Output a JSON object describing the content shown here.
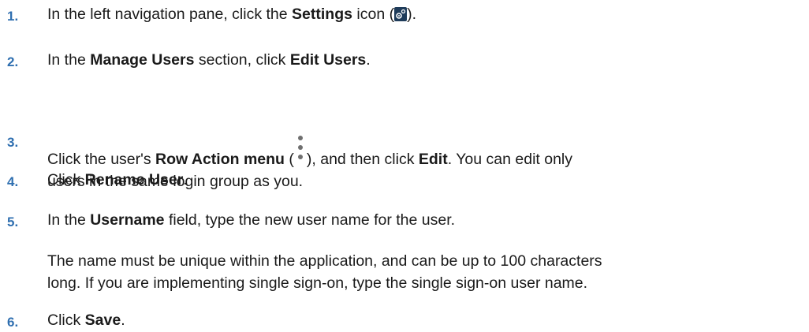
{
  "steps": [
    {
      "number": "1.",
      "lines": [
        [
          {
            "t": "In the left navigation pane, click the ",
            "b": false
          },
          {
            "t": "Settings",
            "b": true
          },
          {
            "t": " icon (",
            "b": false
          },
          {
            "icon": "gear-icon"
          },
          {
            "t": ").",
            "b": false
          }
        ]
      ]
    },
    {
      "number": "2.",
      "lines": [
        [
          {
            "t": "In the ",
            "b": false
          },
          {
            "t": "Manage Users",
            "b": true
          },
          {
            "t": " section, click ",
            "b": false
          },
          {
            "t": "Edit Users",
            "b": true
          },
          {
            "t": ".",
            "b": false
          }
        ]
      ]
    },
    {
      "number": "3.",
      "lines": [
        [
          {
            "t": "Click the user's ",
            "b": false
          },
          {
            "t": "Row Action menu",
            "b": true
          },
          {
            "t": " (",
            "b": false
          },
          {
            "icon": "kebab-icon"
          },
          {
            "t": "), and then click ",
            "b": false
          },
          {
            "t": "Edit",
            "b": true
          },
          {
            "t": ". You can edit only",
            "b": false
          }
        ],
        [
          {
            "t": "users in the same login group as you.",
            "b": false
          }
        ]
      ]
    },
    {
      "number": "4.",
      "lines": [
        [
          {
            "t": "Click ",
            "b": false
          },
          {
            "t": "Rename User",
            "b": true
          },
          {
            "t": ".",
            "b": false
          }
        ]
      ]
    },
    {
      "number": "5.",
      "lines": [
        [
          {
            "t": "In the ",
            "b": false
          },
          {
            "t": "Username",
            "b": true
          },
          {
            "t": " field, type the new user name for the user.",
            "b": false
          }
        ]
      ]
    },
    {
      "number": "",
      "lines": [
        [
          {
            "t": "The name must be unique within the application, and can be up to 100 characters",
            "b": false
          }
        ],
        [
          {
            "t": "long. If you are implementing single sign-on, type the single sign-on user name.",
            "b": false
          }
        ]
      ]
    },
    {
      "number": "6.",
      "lines": [
        [
          {
            "t": "Click ",
            "b": false
          },
          {
            "t": "Save",
            "b": true
          },
          {
            "t": ".",
            "b": false
          }
        ]
      ]
    }
  ]
}
